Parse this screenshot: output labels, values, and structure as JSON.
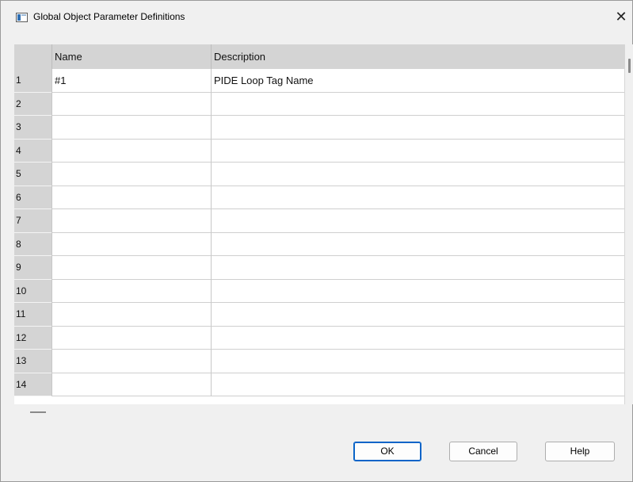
{
  "window": {
    "title": "Global Object Parameter Definitions",
    "close_glyph": "✕",
    "icon": "dialog-window-icon"
  },
  "grid": {
    "columns": [
      "Name",
      "Description"
    ],
    "rows": [
      {
        "num": "1",
        "name": "#1",
        "description": "PIDE Loop Tag Name"
      },
      {
        "num": "2",
        "name": "",
        "description": ""
      },
      {
        "num": "3",
        "name": "",
        "description": ""
      },
      {
        "num": "4",
        "name": "",
        "description": ""
      },
      {
        "num": "5",
        "name": "",
        "description": ""
      },
      {
        "num": "6",
        "name": "",
        "description": ""
      },
      {
        "num": "7",
        "name": "",
        "description": ""
      },
      {
        "num": "8",
        "name": "",
        "description": ""
      },
      {
        "num": "9",
        "name": "",
        "description": ""
      },
      {
        "num": "10",
        "name": "",
        "description": ""
      },
      {
        "num": "11",
        "name": "",
        "description": ""
      },
      {
        "num": "12",
        "name": "",
        "description": ""
      },
      {
        "num": "13",
        "name": "",
        "description": ""
      },
      {
        "num": "14",
        "name": "",
        "description": ""
      }
    ]
  },
  "buttons": {
    "ok": "OK",
    "cancel": "Cancel",
    "help": "Help"
  }
}
